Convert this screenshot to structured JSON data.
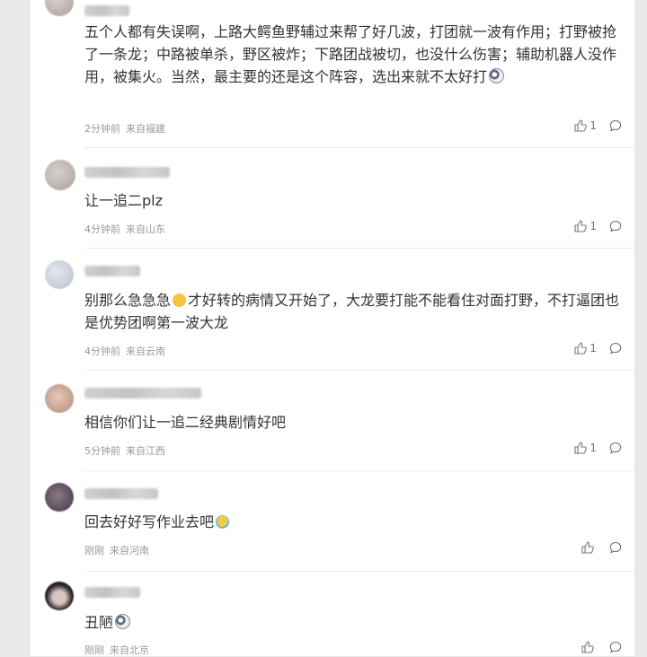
{
  "comments": [
    {
      "text": "五个人都有失误啊，上路大鳄鱼野辅过来帮了好几波，打团就一波有作用；打野被抢了一条龙；中路被单杀，野区被炸；下路团战被切，也没什么伤害；辅助机器人没作用，被集火。当然，最主要的还是这个阵容，选出来就不太好打",
      "emoji": "dog-face-emoji",
      "time": "2分钟前",
      "source": "来自福建",
      "likes": "1"
    },
    {
      "text": "让一追二plz",
      "time": "4分钟前",
      "source": "来自山东",
      "likes": "1"
    },
    {
      "text": "别那么急急急",
      "emoji_mid": "grin-face-emoji",
      "text2": "才好转的病情又开始了，大龙要打能不能看住对面打野，不打逼团也是优势团啊第一波大龙",
      "time": "4分钟前",
      "source": "来自云南",
      "likes": "1"
    },
    {
      "text": "相信你们让一追二经典剧情好吧",
      "time": "5分钟前",
      "source": "来自江西",
      "likes": "1"
    },
    {
      "text": "回去好好写作业去吧",
      "emoji": "laughing-face-emoji",
      "time": "刚刚",
      "source": "来自河南",
      "likes": ""
    },
    {
      "text": "丑陋",
      "emoji": "dog-face-emoji",
      "time": "刚刚",
      "source": "来自北京",
      "likes": ""
    }
  ],
  "colors": {
    "text": "#333333",
    "meta": "#999999",
    "divider": "#ececec",
    "background": "#e9e9e9"
  }
}
